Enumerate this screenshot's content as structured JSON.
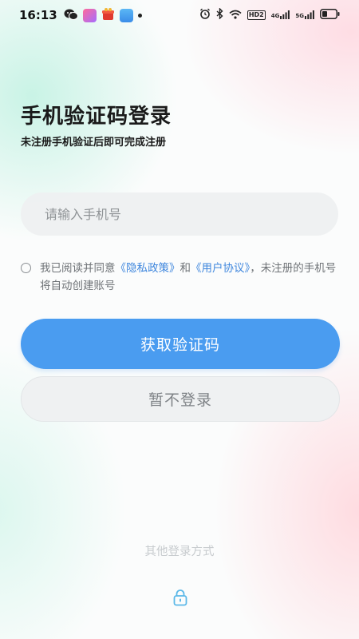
{
  "status_bar": {
    "time": "16:13",
    "hd_label": "HD2",
    "net1_label": "4G",
    "net2_label": "5G"
  },
  "header": {
    "title": "手机验证码登录",
    "subtitle": "未注册手机验证后即可完成注册"
  },
  "phone": {
    "placeholder": "请输入手机号",
    "value": ""
  },
  "agreement": {
    "checked": false,
    "prefix": "我已阅读并同意",
    "privacy_link": "《隐私政策》",
    "and": "和",
    "user_link": "《用户协议》",
    "suffix": "，未注册的手机号将自动创建账号"
  },
  "buttons": {
    "get_code": "获取验证码",
    "skip_login": "暂不登录"
  },
  "other_login": {
    "label": "其他登录方式"
  },
  "colors": {
    "primary": "#4a9cf0",
    "link": "#3e86dd",
    "lock_icon": "#5bb8e8"
  }
}
